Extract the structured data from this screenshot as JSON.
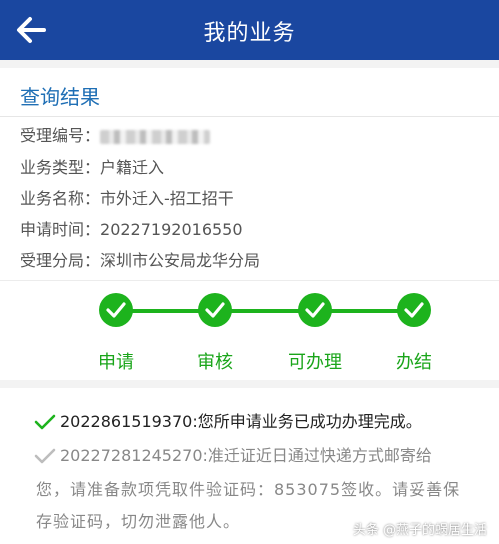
{
  "header": {
    "title": "我的业务",
    "back_icon": "back-arrow-icon"
  },
  "result": {
    "heading": "查询结果",
    "fields": [
      {
        "label": "受理编号：",
        "value": ""
      },
      {
        "label": "业务类型：",
        "value": "户籍迁入"
      },
      {
        "label": "业务名称：",
        "value": "市外迁入-招工招干"
      },
      {
        "label": "申请时间：",
        "value": "20227192016550"
      },
      {
        "label": "受理分局：",
        "value": "深圳市公安局龙华分局"
      }
    ]
  },
  "progress": {
    "steps": [
      "申请",
      "审核",
      "可办理",
      "办结"
    ],
    "completed_count": 4,
    "color": "#1db31d"
  },
  "messages": {
    "first": "2022861519370:您所申请业务已成功办理完成。",
    "second_line1": "20227281245270:准迁证近日通过快递方式邮寄给",
    "second_line2": "您，请准备款项凭取件验证码：853075签收。请妥善保",
    "second_line3": "存验证码，切勿泄露他人。"
  },
  "watermark": "头条 @燕子的蜗居生活",
  "colors": {
    "topbar": "#1a47a0",
    "accent": "#1f6fb5",
    "success": "#1db31d"
  }
}
